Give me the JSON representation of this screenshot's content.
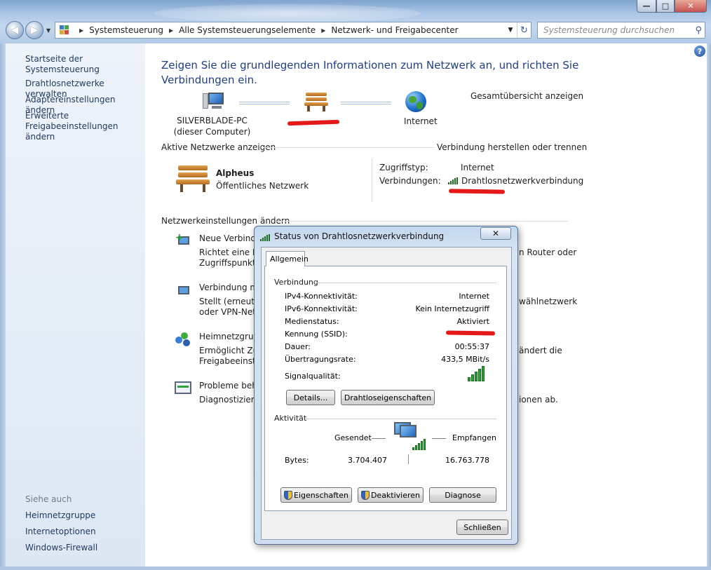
{
  "window": {
    "minimize_glyph": "—",
    "maximize_glyph": "□",
    "close_glyph": "✕"
  },
  "address": {
    "segments": [
      "Systemsteuerung",
      "Alle Systemsteuerungselemente",
      "Netzwerk- und Freigabecenter"
    ],
    "search_placeholder": "Systemsteuerung durchsuchen"
  },
  "sidebar": {
    "items": [
      {
        "label": "Startseite der Systemsteuerung"
      },
      {
        "label": "Drahtlosnetzwerke verwalten"
      },
      {
        "label": "Adaptereinstellungen ändern"
      },
      {
        "label": "Erweiterte"
      },
      {
        "label": "Freigabeeinstellungen ändern"
      }
    ],
    "see_also_title": "Siehe auch",
    "see_also": [
      {
        "label": "Heimnetzgruppe"
      },
      {
        "label": "Internetoptionen"
      },
      {
        "label": "Windows-Firewall"
      }
    ]
  },
  "main": {
    "heading_line1": "Zeigen Sie die grundlegenden Informationen zum Netzwerk an, und richten Sie",
    "heading_line2": "Verbindungen ein.",
    "map_link": "Gesamtübersicht anzeigen",
    "computer_name": "SILVERBLADE-PC",
    "computer_sub": "(dieser Computer)",
    "internet_label": "Internet",
    "active_header": "Aktive Netzwerke anzeigen",
    "connect_link": "Verbindung herstellen oder trennen",
    "network_name": "Alpheus",
    "network_type": "Öffentliches Netzwerk",
    "access_type_label": "Zugriffstyp:",
    "access_type_value": "Internet",
    "connections_label": "Verbindungen:",
    "connections_value": "Drahtlosnetzwerkverbindung",
    "change_header": "Netzwerkeinstellungen ändern",
    "tasks": [
      {
        "title": "Neue Verbindung",
        "desc1": "Richtet eine Dr",
        "desc1_tail": "n Router oder",
        "desc2": "Zugriffspunkt e"
      },
      {
        "title": "Verbindung mi",
        "desc1": "Stellt (erneut) e",
        "desc1_tail": "wählnetzwerk",
        "desc2": "oder VPN-Netz"
      },
      {
        "title": "Heimnetzgrupp",
        "desc1": "Ermöglicht Zug",
        "desc1_tail": "ändert die",
        "desc2": "Freigabeeinstel"
      },
      {
        "title": "Probleme behe",
        "desc1": "Diagnostiziert u",
        "desc1_tail": "ionen ab.",
        "desc2": ""
      }
    ]
  },
  "dialog": {
    "title": "Status von Drahtlosnetzwerkverbindung",
    "close_glyph": "✕",
    "tab": "Allgemein",
    "connection_group": "Verbindung",
    "rows": [
      {
        "label": "IPv4-Konnektivität:",
        "value": "Internet"
      },
      {
        "label": "IPv6-Konnektivität:",
        "value": "Kein Internetzugriff"
      },
      {
        "label": "Medienstatus:",
        "value": "Aktiviert"
      },
      {
        "label": "Kennung (SSID):",
        "value": ""
      },
      {
        "label": "Dauer:",
        "value": "00:55:37"
      },
      {
        "label": "Übertragungsrate:",
        "value": "433,5 MBit/s"
      }
    ],
    "signal_label": "Signalqualität:",
    "signal_bars": 5,
    "btn_details": "Details...",
    "btn_wireless": "Drahtloseigenschaften",
    "activity_group": "Aktivität",
    "sent_label": "Gesendet",
    "received_label": "Empfangen",
    "bytes_label": "Bytes:",
    "bytes_sent": "3.704.407",
    "bytes_received": "16.763.778",
    "btn_properties": "Eigenschaften",
    "btn_disable": "Deaktivieren",
    "btn_diagnose": "Diagnose",
    "btn_close": "Schließen"
  }
}
